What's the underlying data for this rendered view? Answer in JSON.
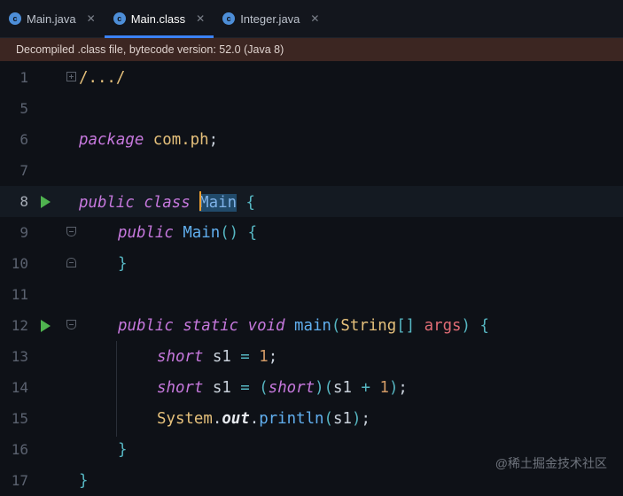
{
  "tabs": [
    {
      "label": "Main.java",
      "icon": "java-class-icon",
      "active": false
    },
    {
      "label": "Main.class",
      "icon": "java-class-icon",
      "active": true
    },
    {
      "label": "Integer.java",
      "icon": "java-class-icon",
      "active": false
    }
  ],
  "banner": {
    "text": "Decompiled .class file, bytecode version: 52.0 (Java 8)"
  },
  "lines": [
    {
      "n": "1"
    },
    {
      "n": "5"
    },
    {
      "n": "6"
    },
    {
      "n": "7"
    },
    {
      "n": "8"
    },
    {
      "n": "9"
    },
    {
      "n": "10"
    },
    {
      "n": "11"
    },
    {
      "n": "12"
    },
    {
      "n": "13"
    },
    {
      "n": "14"
    },
    {
      "n": "15"
    },
    {
      "n": "16"
    },
    {
      "n": "17"
    }
  ],
  "code": {
    "l1": "/.../",
    "l6_kw": "package",
    "l6_pkg": "com.ph",
    "l8_kw1": "public",
    "l8_kw2": "class",
    "l8_cls": "Main",
    "l9_kw": "public",
    "l9_fn": "Main",
    "l12_kw1": "public",
    "l12_kw2": "static",
    "l12_kw3": "void",
    "l12_fn": "main",
    "l12_typ": "String",
    "l12_par": "args",
    "l13_kw": "short",
    "l13_var": "s1",
    "l13_num": "1",
    "l14_kw": "short",
    "l14_var": "s1",
    "l14_cast": "short",
    "l14_var2": "s1",
    "l14_num": "1",
    "l15_cls": "System",
    "l15_fld": "out",
    "l15_fn": "println",
    "l15_arg": "s1"
  },
  "watermark": "@稀土掘金技术社区"
}
